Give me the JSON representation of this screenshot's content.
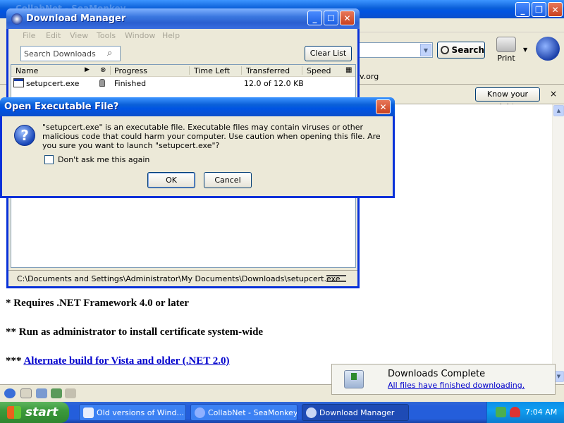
{
  "browser": {
    "title": "CollabNet - SeaMonkey",
    "search_label": "Search",
    "print_label": "Print",
    "tab_url_fragment": "v.org",
    "know_rights_label": "Know your rights",
    "close_glyph": "×",
    "page_lines": {
      "line1": "* Requires .NET Framework 4.0 or later",
      "line2": "** Run as administrator to install certificate system-wide",
      "line3_prefix": "*** ",
      "line3_link": "Alternate build for Vista and older (.NET 2.0)"
    }
  },
  "download_manager": {
    "title": "Download Manager",
    "menu": [
      "File",
      "Edit",
      "View",
      "Tools",
      "Window",
      "Help"
    ],
    "search_placeholder": "Search Downloads",
    "clear_list_label": "Clear List",
    "columns": [
      "Name",
      "Progress",
      "Time Left",
      "Transferred",
      "Speed"
    ],
    "rows": [
      {
        "name": "setupcert.exe",
        "progress": "Finished",
        "time_left": "",
        "transferred": "12.0 of 12.0 KB",
        "speed": ""
      }
    ],
    "status_path": "C:\\Documents and Settings\\Administrator\\My Documents\\Downloads\\setupcert.exe"
  },
  "exe_dialog": {
    "title": "Open Executable File?",
    "message": "\"setupcert.exe\" is an executable file. Executable files may contain viruses or other malicious code that could harm your computer. Use caution when opening this file. Are you sure you want to launch \"setupcert.exe\"?",
    "checkbox_label": "Don't ask me this again",
    "checkbox_checked": false,
    "ok_label": "OK",
    "cancel_label": "Cancel"
  },
  "download_popup": {
    "title": "Downloads Complete",
    "link": "All files have finished downloading."
  },
  "taskbar": {
    "start_label": "start",
    "tasks": [
      {
        "label": "Old versions of Wind...",
        "active": false
      },
      {
        "label": "CollabNet - SeaMonkey",
        "active": false
      },
      {
        "label": "Download Manager",
        "active": true
      }
    ],
    "clock": "7:04 AM"
  },
  "colors": {
    "xp_blue": "#0054e3",
    "start_green": "#3c9a3c",
    "link_blue": "#0000cc"
  }
}
